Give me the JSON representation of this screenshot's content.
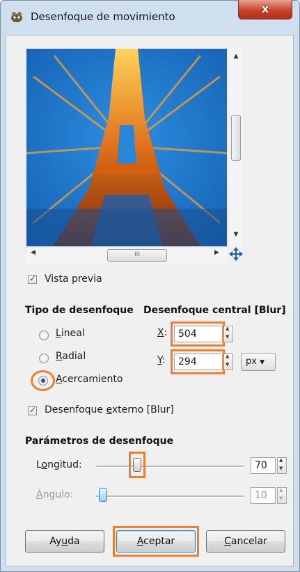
{
  "window": {
    "title": "Desenfoque de movimiento",
    "close_label": "x"
  },
  "preview": {
    "toggle_label_pre": "",
    "toggle_label": "Vista previa",
    "checked": true
  },
  "blur_type": {
    "title": "Tipo de desenfoque",
    "options": [
      {
        "pre": "",
        "acc": "L",
        "post": "ineal",
        "selected": false
      },
      {
        "pre": "",
        "acc": "R",
        "post": "adial",
        "selected": false
      },
      {
        "pre": "",
        "acc": "A",
        "post": "cercamiento",
        "selected": true
      }
    ]
  },
  "center": {
    "title": "Desenfoque central [Blur]",
    "x_label": "X",
    "x_value": "504",
    "y_label": "Y",
    "y_value": "294",
    "unit": "px"
  },
  "outer_blur": {
    "pre": "Desenfoque ",
    "acc": "e",
    "post": "xterno [Blur]",
    "checked": true
  },
  "params": {
    "title": "Parámetros de desenfoque",
    "length": {
      "pre": "L",
      "acc": "o",
      "post": "ngitud:",
      "value": "70",
      "position_fraction": 0.27
    },
    "angle": {
      "pre": "",
      "acc": "Á",
      "post": "ngulo:",
      "value": "10",
      "position_fraction": 0.03,
      "enabled": false
    }
  },
  "buttons": {
    "help": {
      "pre": "Ay",
      "acc": "u",
      "post": "da"
    },
    "ok": {
      "pre": "",
      "acc": "A",
      "post": "ceptar"
    },
    "cancel": {
      "pre": "",
      "acc": "C",
      "post": "ancelar"
    }
  },
  "scroll_grip": "III",
  "colors": {
    "highlight": "#ee7f2d",
    "sky": "#1f7fd0",
    "tower": "#e07818"
  }
}
